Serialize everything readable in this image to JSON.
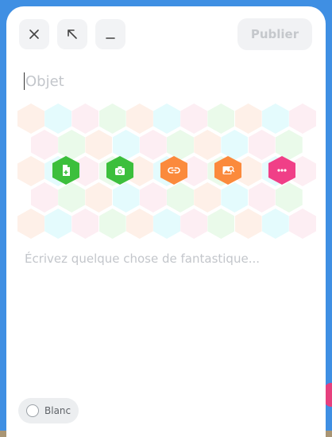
{
  "toolbar": {
    "close_icon": "close-icon",
    "expand_icon": "arrow-up-left-icon",
    "minimize_icon": "minimize-icon",
    "publish_label": "Publier"
  },
  "compose": {
    "subject_placeholder": "Objet",
    "body_placeholder": "Écrivez quelque chose de fantastique..."
  },
  "attachments": [
    {
      "name": "document-add-icon",
      "color": "#3cbf3c"
    },
    {
      "name": "camera-icon",
      "color": "#3cbf3c"
    },
    {
      "name": "link-icon",
      "color": "#fb8a3c"
    },
    {
      "name": "image-search-icon",
      "color": "#fb8a3c"
    },
    {
      "name": "more-icon",
      "color": "#f03f87"
    }
  ],
  "background_color": {
    "label": "Blanc"
  },
  "colors": {
    "hex_pattern": [
      "#fef0e8",
      "#e4fbfd",
      "#fdeef3",
      "#eafaea"
    ]
  }
}
